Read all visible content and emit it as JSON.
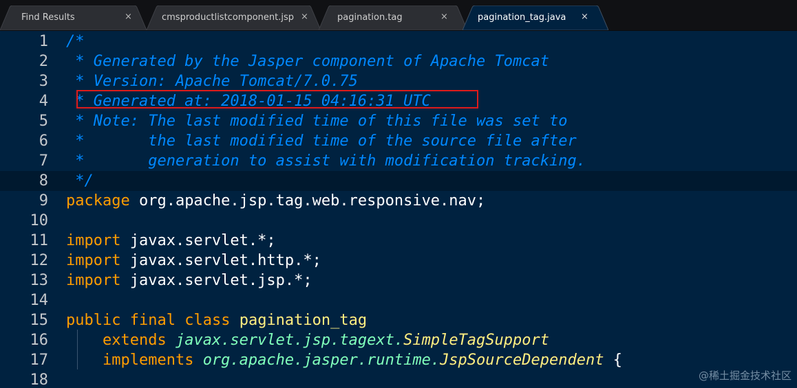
{
  "tabs": [
    {
      "label": "Find Results",
      "close": "×",
      "active": false
    },
    {
      "label": "cmsproductlistcomponent.jsp",
      "close": "×",
      "active": false
    },
    {
      "label": "pagination.tag",
      "close": "×",
      "active": false
    },
    {
      "label": "pagination_tag.java",
      "close": "×",
      "active": true
    }
  ],
  "lines": [
    {
      "num": "1",
      "segs": [
        [
          "comment",
          "/*"
        ]
      ]
    },
    {
      "num": "2",
      "segs": [
        [
          "comment",
          " * Generated by the Jasper component of Apache Tomcat"
        ]
      ]
    },
    {
      "num": "3",
      "segs": [
        [
          "comment",
          " * Version: Apache Tomcat/7.0.75"
        ]
      ]
    },
    {
      "num": "4",
      "segs": [
        [
          "comment",
          " * Generated at: 2018-01-15 04:16:31 UTC"
        ]
      ]
    },
    {
      "num": "5",
      "segs": [
        [
          "comment",
          " * Note: The last modified time of this file was set to"
        ]
      ]
    },
    {
      "num": "6",
      "segs": [
        [
          "comment",
          " *       the last modified time of the source file after"
        ]
      ]
    },
    {
      "num": "7",
      "segs": [
        [
          "comment",
          " *       generation to assist with modification tracking."
        ]
      ]
    },
    {
      "num": "8",
      "segs": [
        [
          "comment",
          " */"
        ]
      ],
      "current": true
    },
    {
      "num": "9",
      "segs": [
        [
          "kw",
          "package"
        ],
        [
          "plain",
          " org.apache.jsp.tag.web.responsive.nav;"
        ]
      ]
    },
    {
      "num": "10",
      "segs": []
    },
    {
      "num": "11",
      "segs": [
        [
          "kw",
          "import"
        ],
        [
          "plain",
          " javax.servlet.*;"
        ]
      ]
    },
    {
      "num": "12",
      "segs": [
        [
          "kw",
          "import"
        ],
        [
          "plain",
          " javax.servlet.http.*;"
        ]
      ]
    },
    {
      "num": "13",
      "segs": [
        [
          "kw",
          "import"
        ],
        [
          "plain",
          " javax.servlet.jsp.*;"
        ]
      ]
    },
    {
      "num": "14",
      "segs": []
    },
    {
      "num": "15",
      "segs": [
        [
          "kw",
          "public"
        ],
        [
          "plain",
          " "
        ],
        [
          "kw",
          "final"
        ],
        [
          "plain",
          " "
        ],
        [
          "kw",
          "class"
        ],
        [
          "plain",
          " "
        ],
        [
          "cls",
          "pagination_tag"
        ]
      ]
    },
    {
      "num": "16",
      "segs": [
        [
          "plain",
          "    "
        ],
        [
          "kw",
          "extends"
        ],
        [
          "plain",
          " "
        ],
        [
          "super",
          "javax.servlet.jsp.tagext."
        ],
        [
          "type",
          "SimpleTagSupport"
        ]
      ]
    },
    {
      "num": "17",
      "segs": [
        [
          "plain",
          "    "
        ],
        [
          "kw",
          "implements"
        ],
        [
          "plain",
          " "
        ],
        [
          "super",
          "org.apache.jasper.runtime."
        ],
        [
          "type",
          "JspSourceDependent"
        ],
        [
          "plain",
          " {"
        ]
      ]
    },
    {
      "num": "18",
      "segs": []
    }
  ],
  "watermark": "@稀土掘金技术社区",
  "colors": {
    "background": "#002240",
    "comment": "#0088ff",
    "keyword": "#ff9d00",
    "class_name": "#ffee80",
    "supertype": "#80ffbb",
    "highlight_box": "#e01b1b"
  }
}
